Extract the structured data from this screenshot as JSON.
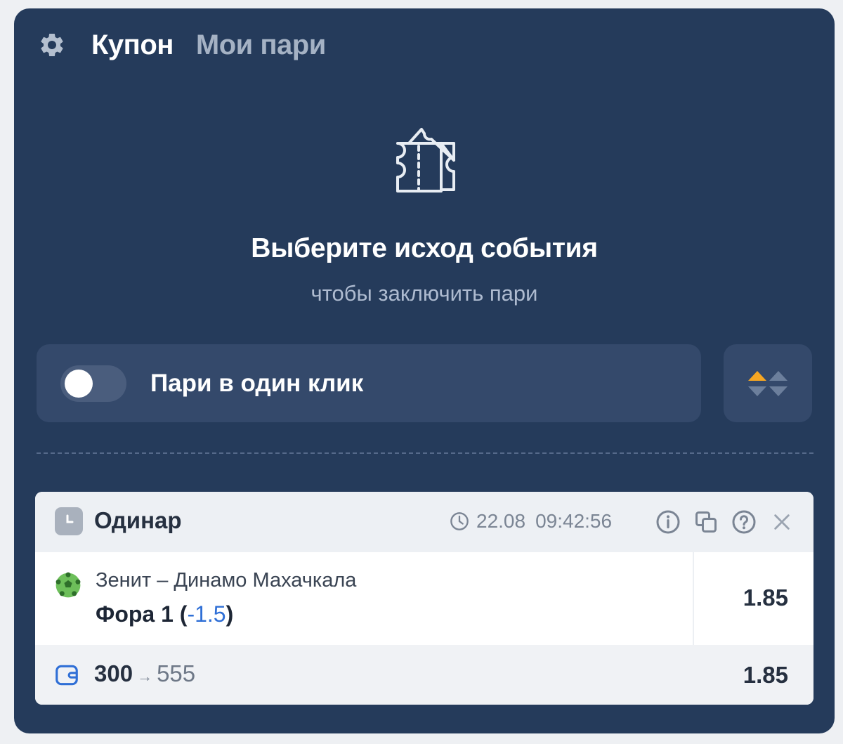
{
  "header": {
    "settings_icon": "gear-icon",
    "tab_coupon": "Купон",
    "tab_my_bets": "Мои пари"
  },
  "empty_state": {
    "icon": "coupon-ticket-icon",
    "title": "Выберите исход события",
    "subtitle": "чтобы заключить пари"
  },
  "one_click": {
    "label": "Пари в один клик",
    "enabled": false
  },
  "sort": {
    "icon": "sort-arrows-icon"
  },
  "bet_slip": {
    "type": "Одинар",
    "date": "22.08",
    "time": "09:42:56",
    "icons": [
      "clock-icon",
      "info-icon",
      "copy-icon",
      "help-icon",
      "close-icon"
    ],
    "event": {
      "sport_icon": "football-icon",
      "teams": "Зенит – Динамо Махачкала",
      "market_prefix": "Фора 1 (",
      "handicap": "-1.5",
      "market_suffix": ")",
      "odd": "1.85"
    },
    "summary": {
      "stake": "300",
      "arrow": "→",
      "win": "555",
      "odd": "1.85"
    }
  },
  "colors": {
    "panel_bg": "#253b5b",
    "card_bg": "#34496b",
    "accent_orange": "#f5a623",
    "link_blue": "#2f6fd6"
  }
}
